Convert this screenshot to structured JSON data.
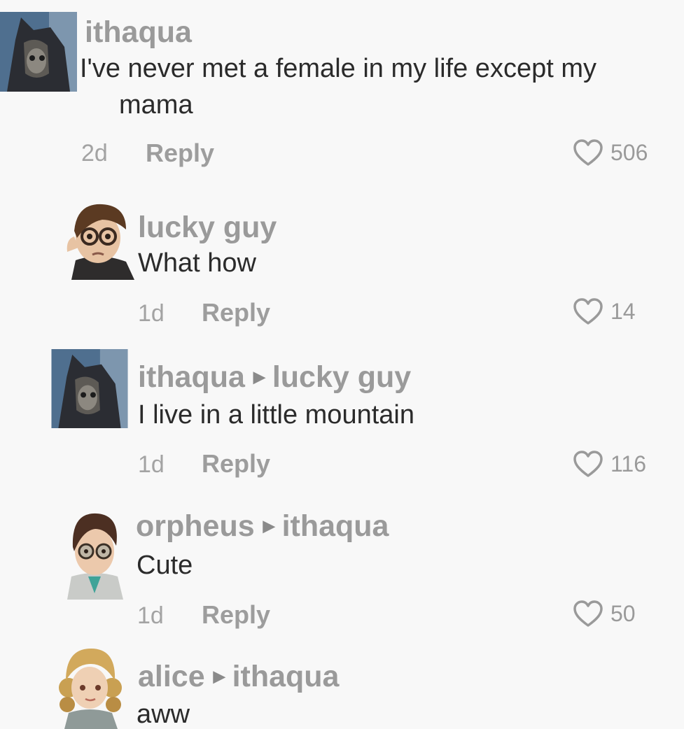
{
  "comments": [
    {
      "username": "ithaqua",
      "reply_to": "",
      "text_line1": "I've never met a female in my life except my",
      "text_line2": "mama",
      "age": "2d",
      "reply_label": "Reply",
      "likes": "506",
      "avatar": "ithaqua-avatar"
    },
    {
      "username": "lucky guy",
      "reply_to": "",
      "text": "What how",
      "age": "1d",
      "reply_label": "Reply",
      "likes": "14",
      "avatar": "lucky-guy-avatar"
    },
    {
      "username": "ithaqua",
      "reply_to": "lucky guy",
      "text": "I live in a little mountain",
      "age": "1d",
      "reply_label": "Reply",
      "likes": "116",
      "avatar": "ithaqua-avatar"
    },
    {
      "username": "orpheus",
      "reply_to": "ithaqua",
      "text": "Cute",
      "age": "1d",
      "reply_label": "Reply",
      "likes": "50",
      "avatar": "orpheus-avatar"
    },
    {
      "username": "alice",
      "reply_to": "ithaqua",
      "text": "aww",
      "avatar": "alice-avatar"
    }
  ],
  "icons": {
    "like": "heart-outline-icon",
    "reply_arrow": "triangle-right-icon"
  },
  "colors": {
    "username": "#9a9a9a",
    "text": "#2b2b2b",
    "meta": "#a3a3a3",
    "background": "#f8f8f8"
  }
}
